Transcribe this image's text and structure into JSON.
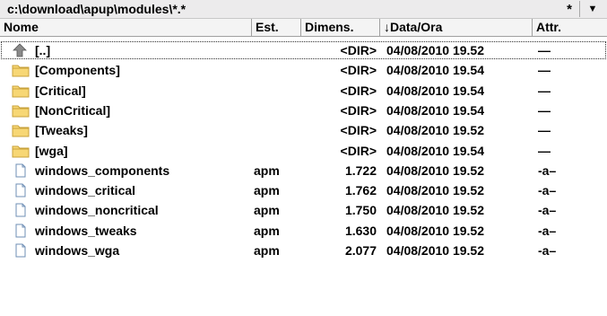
{
  "path_bar": {
    "path": "c:\\download\\apup\\modules\\*.*",
    "filter_glyph": "*",
    "history_glyph": "▼"
  },
  "columns": {
    "name": "Nome",
    "ext": "Est.",
    "size": "Dimens.",
    "date": "↓Data/Ora",
    "attr": "Attr."
  },
  "rows": [
    {
      "icon": "up-arrow-icon",
      "name": "[..]",
      "ext": "",
      "size": "<DIR>",
      "date": "04/08/2010 19.52",
      "attr": "—"
    },
    {
      "icon": "folder-icon",
      "name": "[Components]",
      "ext": "",
      "size": "<DIR>",
      "date": "04/08/2010 19.54",
      "attr": "—"
    },
    {
      "icon": "folder-icon",
      "name": "[Critical]",
      "ext": "",
      "size": "<DIR>",
      "date": "04/08/2010 19.54",
      "attr": "—"
    },
    {
      "icon": "folder-icon",
      "name": "[NonCritical]",
      "ext": "",
      "size": "<DIR>",
      "date": "04/08/2010 19.54",
      "attr": "—"
    },
    {
      "icon": "folder-icon",
      "name": "[Tweaks]",
      "ext": "",
      "size": "<DIR>",
      "date": "04/08/2010 19.52",
      "attr": "—"
    },
    {
      "icon": "folder-icon",
      "name": "[wga]",
      "ext": "",
      "size": "<DIR>",
      "date": "04/08/2010 19.54",
      "attr": "—"
    },
    {
      "icon": "file-icon",
      "name": "windows_components",
      "ext": "apm",
      "size": "1.722",
      "date": "04/08/2010 19.52",
      "attr": "-a–"
    },
    {
      "icon": "file-icon",
      "name": "windows_critical",
      "ext": "apm",
      "size": "1.762",
      "date": "04/08/2010 19.52",
      "attr": "-a–"
    },
    {
      "icon": "file-icon",
      "name": "windows_noncritical",
      "ext": "apm",
      "size": "1.750",
      "date": "04/08/2010 19.52",
      "attr": "-a–"
    },
    {
      "icon": "file-icon",
      "name": "windows_tweaks",
      "ext": "apm",
      "size": "1.630",
      "date": "04/08/2010 19.52",
      "attr": "-a–"
    },
    {
      "icon": "file-icon",
      "name": "windows_wga",
      "ext": "apm",
      "size": "2.077",
      "date": "04/08/2010 19.52",
      "attr": "-a–"
    }
  ],
  "selected_row": 0,
  "colors": {
    "path_bar_bg": "#ecebec",
    "header_bg": "#f4f4f4",
    "folder_fill": "#f7d775",
    "folder_stroke": "#c8a23a",
    "file_stroke": "#6f8fb6",
    "up_arrow": "#8a8a8a"
  }
}
